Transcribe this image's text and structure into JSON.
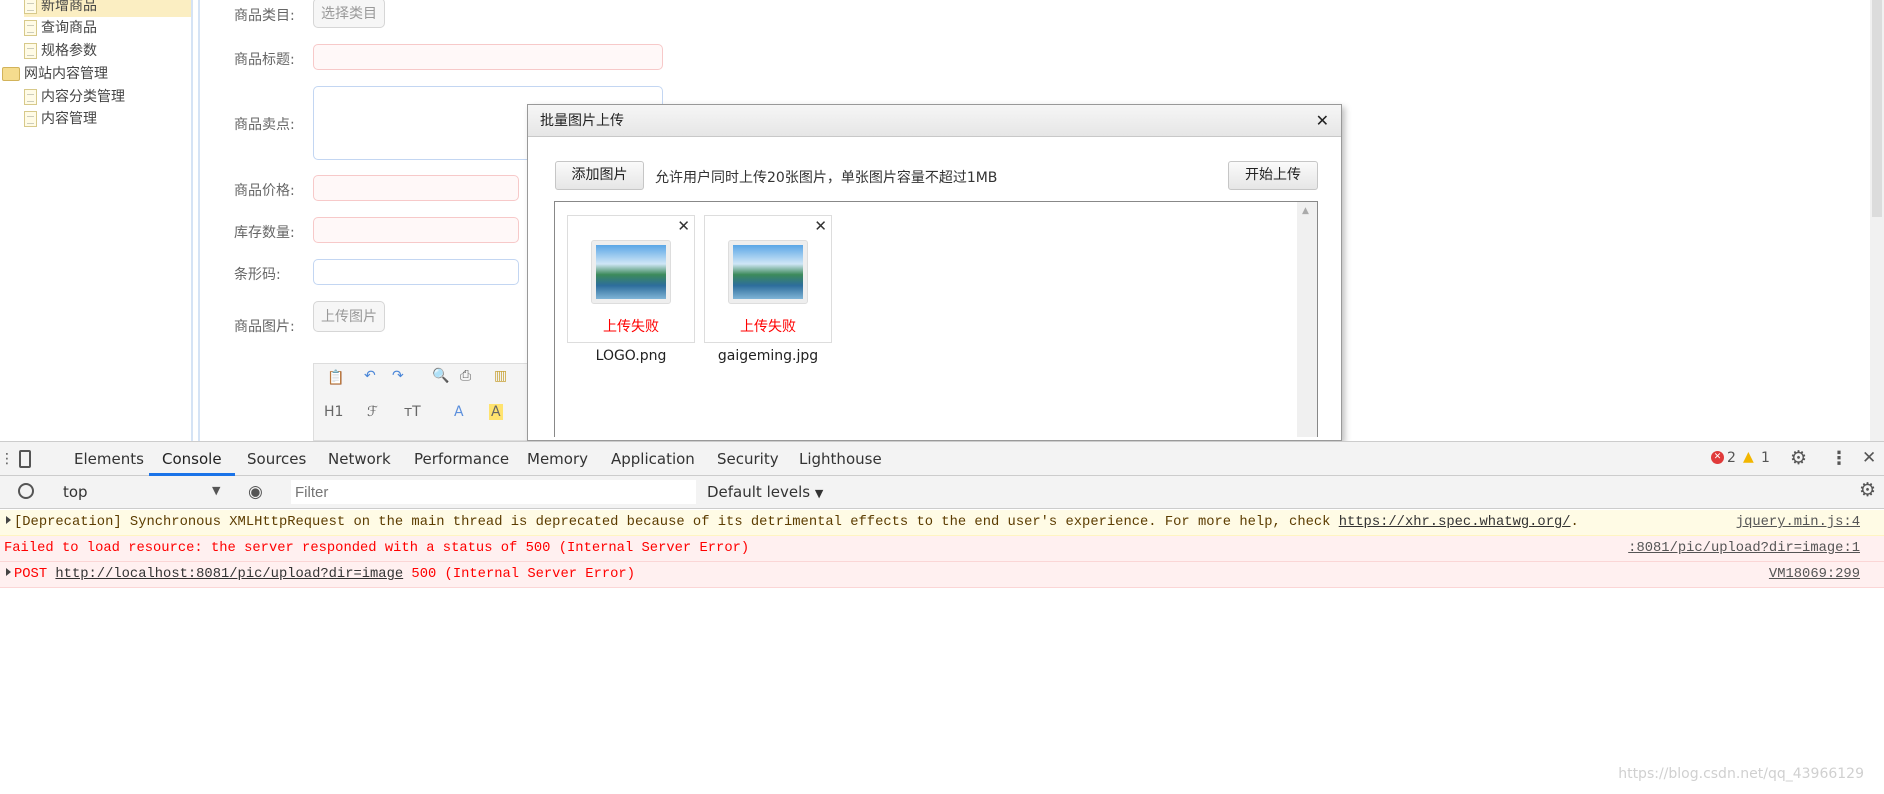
{
  "sidebar": {
    "items": [
      {
        "label": "新增商品",
        "type": "doc",
        "active": true
      },
      {
        "label": "查询商品",
        "type": "doc"
      },
      {
        "label": "规格参数",
        "type": "doc"
      },
      {
        "label": "网站内容管理",
        "type": "folder"
      },
      {
        "label": "内容分类管理",
        "type": "doc"
      },
      {
        "label": "内容管理",
        "type": "doc"
      }
    ]
  },
  "form": {
    "category_label": "商品类目:",
    "category_button": "选择类目",
    "title_label": "商品标题:",
    "title_value": "",
    "sellpoint_label": "商品卖点:",
    "sellpoint_value": "",
    "price_label": "商品价格:",
    "price_value": "",
    "stock_label": "库存数量:",
    "stock_value": "",
    "barcode_label": "条形码:",
    "barcode_value": "",
    "image_label": "商品图片:",
    "image_button": "上传图片",
    "editor_toolbar": {
      "heading": "H1",
      "font": "ℱ",
      "size": "тT",
      "forecolor": "A",
      "backcolor": "A"
    }
  },
  "dialog": {
    "title": "批量图片上传",
    "add_button": "添加图片",
    "hint": "允许用户同时上传20张图片，单张图片容量不超过1MB",
    "start_button": "开始上传",
    "files": [
      {
        "name": "LOGO.png",
        "status": "上传失败"
      },
      {
        "name": "gaigeming.jpg",
        "status": "上传失败"
      }
    ]
  },
  "devtools": {
    "tabs": [
      "Elements",
      "Console",
      "Sources",
      "Network",
      "Performance",
      "Memory",
      "Application",
      "Security",
      "Lighthouse"
    ],
    "active_tab": "Console",
    "error_count": "2",
    "warning_count": "1",
    "context": "top",
    "filter_placeholder": "Filter",
    "levels": "Default levels",
    "messages": [
      {
        "level": "warning",
        "text": "[Deprecation] Synchronous XMLHttpRequest on the main thread is deprecated because of its detrimental effects to the end user's experience. For more help, check ",
        "link": "https://xhr.spec.whatwg.org/",
        "suffix": ".",
        "source": "jquery.min.js:4"
      },
      {
        "level": "error",
        "text": "Failed to load resource: the server responded with a status of 500 (Internal Server Error)",
        "source": ":8081/pic/upload?dir=image:1"
      },
      {
        "level": "error",
        "text": "POST ",
        "link": "http://localhost:8081/pic/upload?dir=image",
        "suffix": " 500 (Internal Server Error)",
        "source": "VM18069:299"
      }
    ]
  },
  "watermark": "https://blog.csdn.net/qq_43966129",
  "colors": {
    "error": "#ff0000",
    "warning_bg": "#fffbe5",
    "error_bg": "#fff0f0",
    "accent": "#1a73e8",
    "active_item": "#fbeec2"
  }
}
